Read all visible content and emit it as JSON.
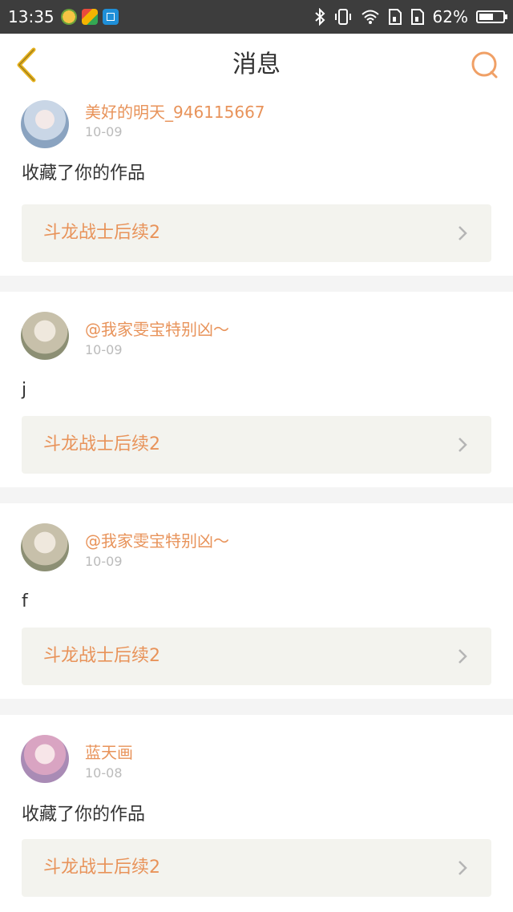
{
  "status_bar": {
    "time": "13:35",
    "battery_percent": "62%",
    "battery_level": 0.62
  },
  "header": {
    "title": "消息"
  },
  "messages": [
    {
      "username": "美好的明天_946115667",
      "date": "10-09",
      "text": "收藏了你的作品",
      "work_title": "斗龙战士后续2"
    },
    {
      "username": "@我家雯宝特别凶～",
      "date": "10-09",
      "text": "j",
      "work_title": "斗龙战士后续2"
    },
    {
      "username": "@我家雯宝特别凶～",
      "date": "10-09",
      "text": "f",
      "work_title": "斗龙战士后续2"
    },
    {
      "username": "蓝天画",
      "date": "10-08",
      "text": "收藏了你的作品",
      "work_title": "斗龙战士后续2"
    }
  ],
  "colors": {
    "accent": "#e8935a",
    "back_arrow": "#e8b31f",
    "status_bar_bg": "#3d3d3d"
  }
}
